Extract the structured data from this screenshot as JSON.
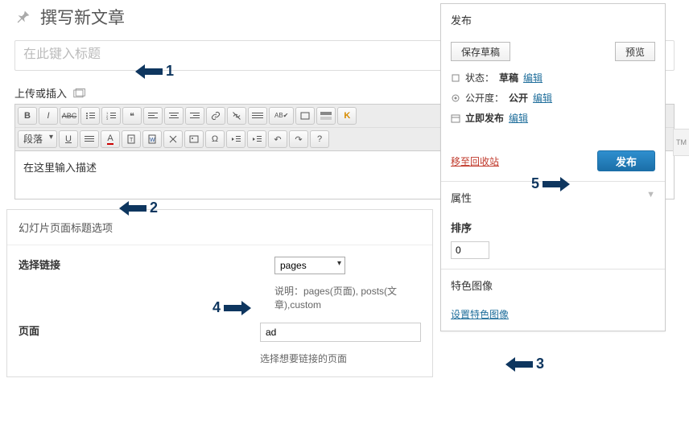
{
  "page_title": "撰写新文章",
  "title_placeholder": "在此键入标题",
  "upload_label": "上传或插入",
  "toolbar": {
    "format_select": "段落",
    "row1": [
      "B",
      "I",
      "ABC",
      "list-ul",
      "list-ol",
      "quote",
      "align-l",
      "align-c",
      "align-r",
      "link",
      "unlink",
      "break",
      "spell",
      "fullscreen",
      "kitchen",
      "K"
    ],
    "row2_after_select": [
      "U",
      "align-j",
      "color",
      "paste-txt",
      "paste-word",
      "eraser",
      "media",
      "omega",
      "outdent",
      "indent",
      "undo",
      "redo",
      "help"
    ]
  },
  "editor_hint": "在这里输入描述",
  "slides": {
    "heading": "幻灯片页面标题选项",
    "link_label": "选择链接",
    "link_select": "pages",
    "link_desc": "说明：pages(页面), posts(文章),custom",
    "page_label": "页面",
    "page_value": "ad",
    "page_desc": "选择想要链接的页面"
  },
  "publish": {
    "title": "发布",
    "save_draft": "保存草稿",
    "preview": "预览",
    "status_label": "状态：",
    "status_value": "草稿",
    "edit": "编辑",
    "visibility_label": "公开度：",
    "visibility_value": "公开",
    "schedule_value": "立即发布",
    "trash": "移至回收站",
    "publish_btn": "发布"
  },
  "attrs": {
    "title": "属性",
    "order_label": "排序",
    "order_value": "0"
  },
  "featured": {
    "title": "特色图像",
    "set_link": "设置特色图像"
  },
  "annotations": {
    "n1": "1",
    "n2": "2",
    "n3": "3",
    "n4": "4",
    "n5": "5"
  },
  "tm": "TM"
}
